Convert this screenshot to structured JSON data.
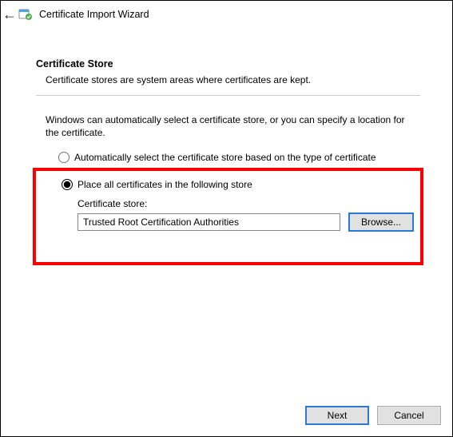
{
  "window": {
    "title": "Certificate Import Wizard"
  },
  "page": {
    "heading": "Certificate Store",
    "subheading": "Certificate stores are system areas where certificates are kept.",
    "instruction": "Windows can automatically select a certificate store, or you can specify a location for the certificate."
  },
  "options": {
    "auto_label": "Automatically select the certificate store based on the type of certificate",
    "place_label": "Place all certificates in the following store",
    "selected": "place"
  },
  "store": {
    "label": "Certificate store:",
    "value": "Trusted Root Certification Authorities",
    "browse_label": "Browse..."
  },
  "footer": {
    "next_label": "Next",
    "cancel_label": "Cancel"
  }
}
